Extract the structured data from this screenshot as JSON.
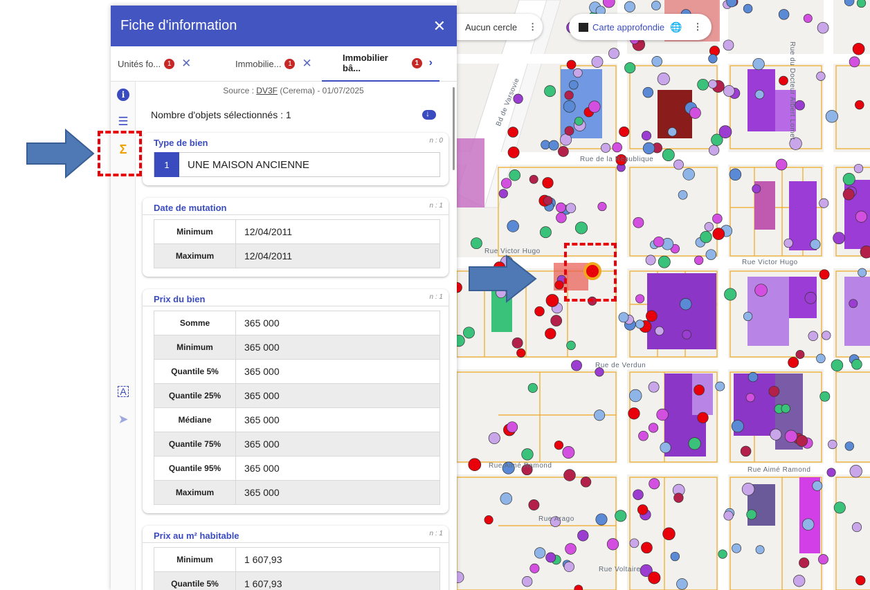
{
  "panel": {
    "title": "Fiche d'information",
    "close": "✕"
  },
  "tabs": [
    {
      "label": "Unités fo...",
      "badge": "1",
      "action": "✕"
    },
    {
      "label": "Immobilie...",
      "badge": "1",
      "action": "✕"
    },
    {
      "label": "Immobilier bâ...",
      "badge": "1",
      "action": "›"
    }
  ],
  "sidebar": {
    "icons": [
      "info-icon",
      "list-icon",
      "sigma-icon",
      "frame-icon",
      "pointer-lock-icon"
    ]
  },
  "source": {
    "prefix": "Source : ",
    "link": "DV3F",
    "suffix": " (Cerema) - 01/07/2025"
  },
  "selection": {
    "count_label": "Nombre d'objets sélectionnés : 1"
  },
  "cards": {
    "type": {
      "title": "Type de bien",
      "n": "n : 0",
      "rows": [
        {
          "num": "1",
          "label": "UNE MAISON ANCIENNE"
        }
      ]
    },
    "date": {
      "title": "Date de mutation",
      "n": "n : 1",
      "rows": [
        {
          "k": "Minimum",
          "v": "12/04/2011"
        },
        {
          "k": "Maximum",
          "v": "12/04/2011"
        }
      ]
    },
    "price": {
      "title": "Prix du bien",
      "n": "n : 1",
      "rows": [
        {
          "k": "Somme",
          "v": "365 000"
        },
        {
          "k": "Minimum",
          "v": "365 000"
        },
        {
          "k": "Quantile 5%",
          "v": "365 000"
        },
        {
          "k": "Quantile 25%",
          "v": "365 000"
        },
        {
          "k": "Médiane",
          "v": "365 000"
        },
        {
          "k": "Quantile 75%",
          "v": "365 000"
        },
        {
          "k": "Quantile 95%",
          "v": "365 000"
        },
        {
          "k": "Maximum",
          "v": "365 000"
        }
      ]
    },
    "m2": {
      "title": "Prix au m² habitable",
      "n": "n : 1",
      "rows": [
        {
          "k": "Minimum",
          "v": "1 607,93"
        },
        {
          "k": "Quantile 5%",
          "v": "1 607,93"
        }
      ]
    }
  },
  "map": {
    "circle_control": {
      "label": "Aucun cercle",
      "menu": "⋮"
    },
    "map_control": {
      "label": "Carte approfondie",
      "menu": "⋮"
    },
    "streets": [
      "Rue de la République",
      "Rue Victor Hugo",
      "Rue Victor Hugo",
      "Rue de Verdun",
      "Rue Aimé Ramond",
      "Rue Aimé Ramond",
      "Rue Arago",
      "Rue Voltaire",
      "Bd de Varsovie",
      "Rue du Docteur Albert Lomet"
    ],
    "colors": {
      "parcel_line": "#f0a81e",
      "selected": "#e8000b",
      "annotation": "#4f79b5"
    }
  }
}
